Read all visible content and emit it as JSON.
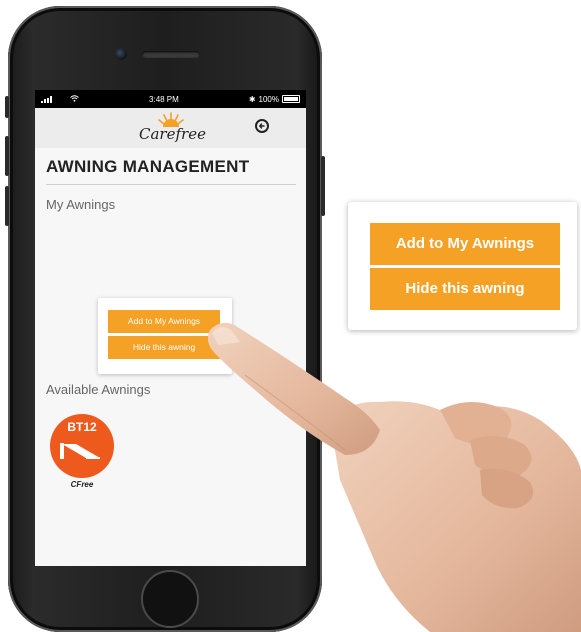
{
  "status_bar": {
    "time": "3:48 PM",
    "battery": "100%"
  },
  "header": {
    "logo_text": "Carefree",
    "back_icon": "back-arrow-circle-icon"
  },
  "page": {
    "title": "AWNING MANAGEMENT"
  },
  "my_awnings": {
    "label": "My Awnings"
  },
  "popup_menu": {
    "add_label": "Add to My Awnings",
    "hide_label": "Hide this awning"
  },
  "available_awnings": {
    "label": "Available Awnings",
    "items": [
      {
        "code": "BT12",
        "name": "CFree",
        "icon": "awning-icon"
      }
    ]
  },
  "callout_menu": {
    "add_label": "Add to My Awnings",
    "hide_label": "Hide this awning"
  },
  "colors": {
    "accent": "#f5a125",
    "awning_badge": "#ee5a1e"
  }
}
